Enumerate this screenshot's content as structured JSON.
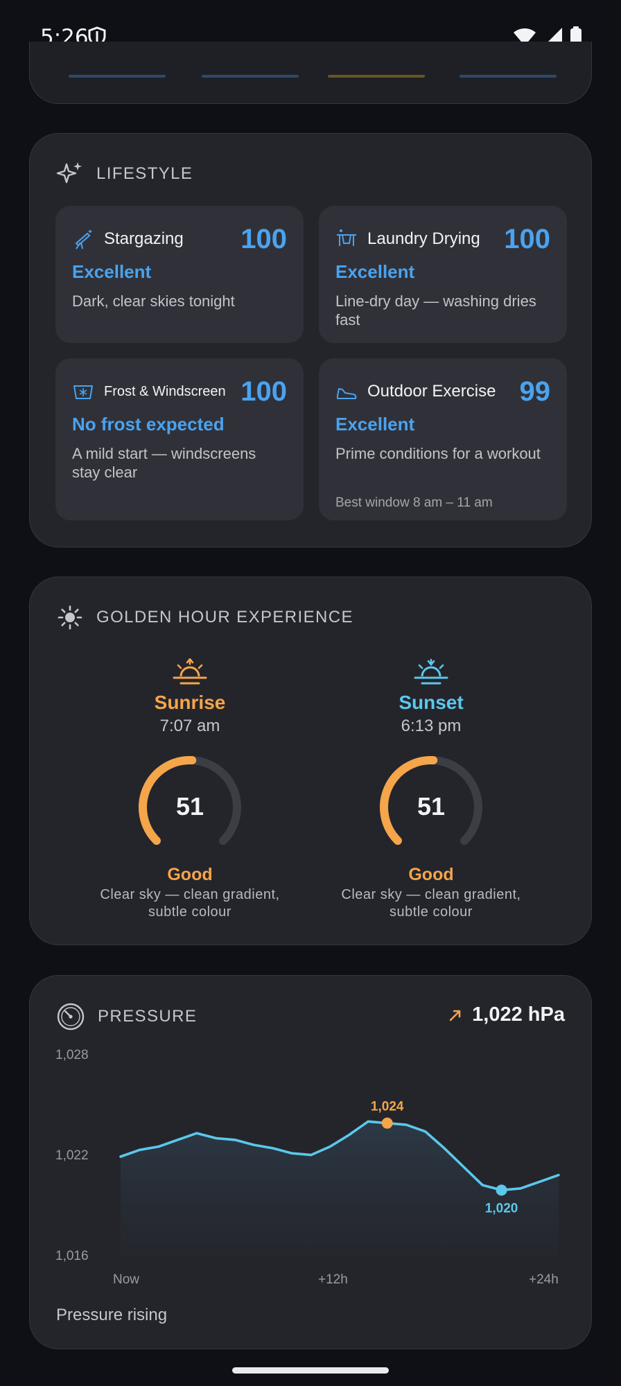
{
  "status_bar": {
    "time": "5:26"
  },
  "lifestyle": {
    "title": "LIFESTYLE",
    "tiles": [
      {
        "name": "Stargazing",
        "score": "100",
        "rating": "Excellent",
        "description": "Dark, clear skies tonight",
        "icon": "telescope-icon"
      },
      {
        "name": "Laundry Drying",
        "score": "100",
        "rating": "Excellent",
        "description": "Line-dry day — washing dries fast",
        "icon": "laundry-icon"
      },
      {
        "name": "Frost & Windscreen",
        "score": "100",
        "rating": "No frost expected",
        "description": "A mild start — windscreens stay clear",
        "icon": "windscreen-frost-icon"
      },
      {
        "name": "Outdoor Exercise",
        "score": "99",
        "rating": "Excellent",
        "description": "Prime conditions for a workout",
        "extra": "Best window 8 am – 11 am",
        "icon": "running-shoe-icon"
      }
    ]
  },
  "golden_hour": {
    "title": "GOLDEN HOUR EXPERIENCE",
    "sunrise": {
      "label": "Sunrise",
      "time": "7:07 am",
      "score": "51",
      "score_fraction": 0.51,
      "rating": "Good",
      "description": "Clear sky — clean gradient, subtle colour"
    },
    "sunset": {
      "label": "Sunset",
      "time": "6:13 pm",
      "score": "51",
      "score_fraction": 0.51,
      "rating": "Good",
      "description": "Clear sky — clean gradient, subtle colour"
    }
  },
  "pressure": {
    "title": "PRESSURE",
    "current": "1,022 hPa",
    "trend_text": "Pressure rising",
    "colors": {
      "line": "#5bc8ec",
      "high": "#f5a54a",
      "low": "#5bc8ec"
    },
    "chart_data": {
      "type": "area",
      "x": [
        0,
        1,
        2,
        3,
        4,
        5,
        6,
        7,
        8,
        9,
        10,
        11,
        12,
        13,
        14,
        15,
        16,
        17,
        18,
        19,
        20,
        21,
        22,
        23
      ],
      "values": [
        1022.0,
        1022.4,
        1022.6,
        1023.0,
        1023.4,
        1023.1,
        1023.0,
        1022.7,
        1022.5,
        1022.2,
        1022.1,
        1022.6,
        1023.3,
        1024.1,
        1024.0,
        1023.9,
        1023.5,
        1022.5,
        1021.4,
        1020.3,
        1020.0,
        1020.1,
        1020.5,
        1020.9
      ],
      "ylim": [
        1016,
        1028
      ],
      "y_ticks": [
        "1,028",
        "1,022",
        "1,016"
      ],
      "x_ticks": [
        "Now",
        "+12h",
        "+24h"
      ],
      "high": {
        "x": 14,
        "value": 1024,
        "label": "1,024"
      },
      "low": {
        "x": 20,
        "value": 1020,
        "label": "1,020"
      }
    }
  }
}
